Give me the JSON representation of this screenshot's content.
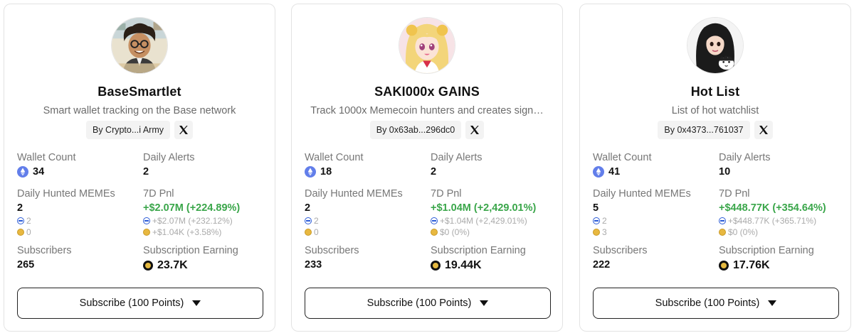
{
  "cards": [
    {
      "name": "BaseSmartlet",
      "description": "Smart wallet tracking on the Base network",
      "by": "By Crypto...i Army",
      "labels": {
        "wallet_count": "Wallet Count",
        "daily_alerts": "Daily Alerts",
        "daily_hunted": "Daily Hunted MEMEs",
        "pnl_7d": "7D Pnl",
        "subscribers": "Subscribers",
        "subscription_earning": "Subscription Earning"
      },
      "wallet_count": "34",
      "daily_alerts": "2",
      "daily_hunted": "2",
      "hunted_base": "2",
      "hunted_other": "0",
      "pnl_total": "+$2.07M (+224.89%)",
      "pnl_base": "+$2.07M (+232.12%)",
      "pnl_other": "+$1.04K (+3.58%)",
      "subscribers": "265",
      "earning": "23.7K",
      "subscribe_label": "Subscribe (100 Points)",
      "avatar_icon": "cartoon-person-avatar"
    },
    {
      "name": "SAKI000x GAINS",
      "description": "Track 1000x Memecoin hunters and creates sign…",
      "by": "By 0x63ab...296dc0",
      "labels": {
        "wallet_count": "Wallet Count",
        "daily_alerts": "Daily Alerts",
        "daily_hunted": "Daily Hunted MEMEs",
        "pnl_7d": "7D Pnl",
        "subscribers": "Subscribers",
        "subscription_earning": "Subscription Earning"
      },
      "wallet_count": "18",
      "daily_alerts": "2",
      "daily_hunted": "2",
      "hunted_base": "2",
      "hunted_other": "0",
      "pnl_total": "+$1.04M (+2,429.01%)",
      "pnl_base": "+$1.04M (+2,429.01%)",
      "pnl_other": "$0 (0%)",
      "subscribers": "233",
      "earning": "19.44K",
      "subscribe_label": "Subscribe (100 Points)",
      "avatar_icon": "anime-girl-avatar"
    },
    {
      "name": "Hot List",
      "description": "List of hot watchlist",
      "by": "By 0x4373...761037",
      "labels": {
        "wallet_count": "Wallet Count",
        "daily_alerts": "Daily Alerts",
        "daily_hunted": "Daily Hunted MEMEs",
        "pnl_7d": "7D Pnl",
        "subscribers": "Subscribers",
        "subscription_earning": "Subscription Earning"
      },
      "wallet_count": "41",
      "daily_alerts": "10",
      "daily_hunted": "5",
      "hunted_base": "2",
      "hunted_other": "3",
      "pnl_total": "+$448.77K (+354.64%)",
      "pnl_base": "+$448.77K (+365.71%)",
      "pnl_other": "$0 (0%)",
      "subscribers": "222",
      "earning": "17.76K",
      "subscribe_label": "Subscribe (100 Points)",
      "avatar_icon": "woman-with-cat-avatar"
    }
  ],
  "colors": {
    "pnl_positive": "#3aa64a",
    "label_gray": "#777777",
    "card_border": "#e3e3e3"
  }
}
